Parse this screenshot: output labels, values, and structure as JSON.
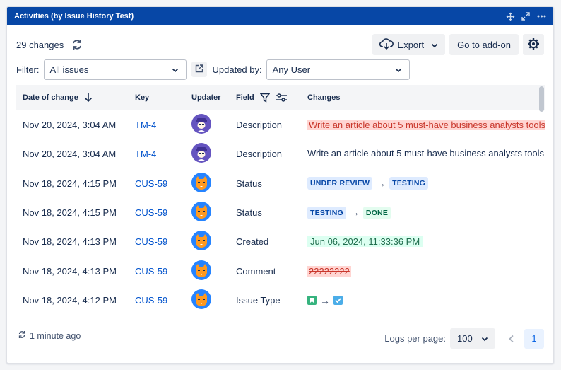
{
  "header": {
    "title": "Activities (by Issue History Test)",
    "icons": [
      "move-icon",
      "expand-icon",
      "more-icon"
    ]
  },
  "toolbar": {
    "changes_count": "29 changes",
    "export_label": "Export",
    "addon_label": "Go to add-on"
  },
  "filters": {
    "filter_label": "Filter:",
    "filter_value": "All issues",
    "updated_by_label": "Updated by:",
    "updated_by_value": "Any User"
  },
  "table": {
    "columns": {
      "date": "Date of change",
      "key": "Key",
      "updater": "Updater",
      "field": "Field",
      "changes": "Changes"
    },
    "rows": [
      {
        "date": "Nov 20, 2024, 3:04 AM",
        "key": "TM-4",
        "avatar": "purple",
        "field": "Description",
        "change_old": "Write an article about 5 must-have business analysts tools |..."
      },
      {
        "date": "Nov 20, 2024, 3:04 AM",
        "key": "TM-4",
        "avatar": "purple",
        "field": "Description",
        "change_new": "Write an article about 5 must-have business analysts tools"
      },
      {
        "date": "Nov 18, 2024, 4:15 PM",
        "key": "CUS-59",
        "avatar": "orange",
        "field": "Status",
        "from": "UNDER REVIEW",
        "to": "TESTING"
      },
      {
        "date": "Nov 18, 2024, 4:15 PM",
        "key": "CUS-59",
        "avatar": "orange",
        "field": "Status",
        "from": "TESTING",
        "to": "DONE"
      },
      {
        "date": "Nov 18, 2024, 4:13 PM",
        "key": "CUS-59",
        "avatar": "orange",
        "field": "Created",
        "created": "Jun 06, 2024, 11:33:36 PM"
      },
      {
        "date": "Nov 18, 2024, 4:13 PM",
        "key": "CUS-59",
        "avatar": "orange",
        "field": "Comment",
        "change_old": "22222222"
      },
      {
        "date": "Nov 18, 2024, 4:12 PM",
        "key": "CUS-59",
        "avatar": "orange",
        "field": "Issue Type",
        "from_icon": "story-icon",
        "to_icon": "task-icon"
      }
    ]
  },
  "footer": {
    "updated": "1 minute ago",
    "logs_per_page_label": "Logs per page:",
    "logs_per_page_value": "100",
    "current_page": "1"
  },
  "colors": {
    "header_bg": "#0747a6",
    "link": "#0052cc",
    "removed_bg": "#ffd5d2",
    "added_bg": "#dcfff1"
  }
}
